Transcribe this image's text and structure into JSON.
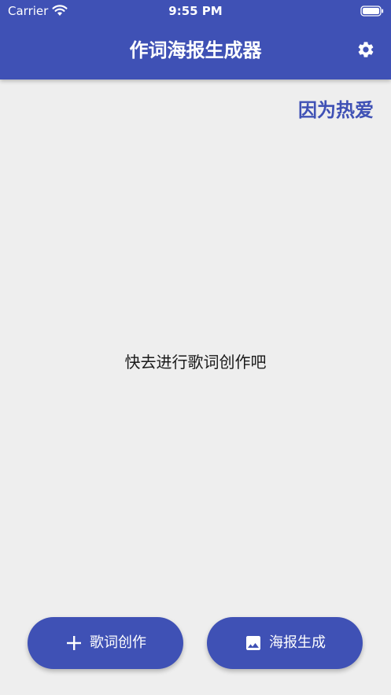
{
  "status_bar": {
    "carrier": "Carrier",
    "time": "9:55 PM"
  },
  "app_bar": {
    "title": "作词海报生成器",
    "background_color": "#3f51b5",
    "settings_icon": "gear-icon"
  },
  "slogan": "因为热爱",
  "empty_state": {
    "message": "快去进行歌词创作吧"
  },
  "actions": {
    "create_lyrics": {
      "label": "歌词创作",
      "icon": "plus-icon"
    },
    "generate_poster": {
      "label": "海报生成",
      "icon": "image-icon"
    }
  },
  "colors": {
    "accent": "#3f51b5",
    "background": "#eeeeee"
  }
}
